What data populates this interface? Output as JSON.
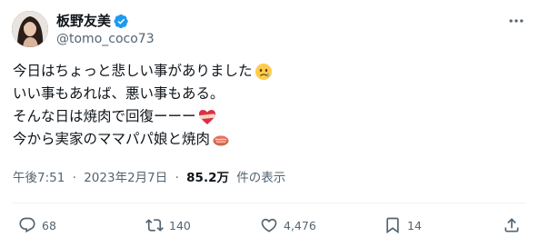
{
  "author": {
    "display_name": "板野友美",
    "handle": "@tomo_coco73",
    "verified": true
  },
  "post": {
    "lines": [
      "今日はちょっと悲しい事がありました",
      "いい事もあれば、悪い事もある。",
      "そんな日は焼肉で回復ーーー",
      "今から実家のママパパ娘と焼肉"
    ],
    "emojis": [
      "crying-face-emoji",
      "heart-with-bandage-emoji",
      "meat-emoji"
    ]
  },
  "meta": {
    "time": "午後7:51",
    "separator": "·",
    "date": "2023年2月7日",
    "views_count": "85.2万",
    "views_label": "件の表示"
  },
  "actions": {
    "reply_count": "68",
    "repost_count": "140",
    "like_count": "4,476",
    "bookmark_count": "14"
  },
  "colors": {
    "text": "#0f1419",
    "secondary": "#536471",
    "verified_blue": "#1d9bf0",
    "divider": "#eff3f4"
  }
}
